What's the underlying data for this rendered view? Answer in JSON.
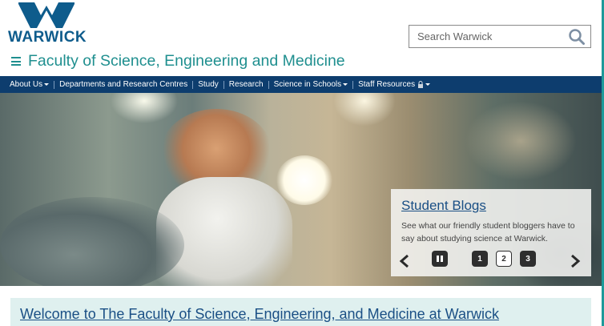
{
  "header": {
    "logo_text": "WARWICK",
    "search": {
      "placeholder": "Search Warwick"
    },
    "faculty_title": "Faculty of Science, Engineering and Medicine"
  },
  "nav": {
    "items": [
      {
        "label": "About Us",
        "has_caret": true
      },
      {
        "label": "Departments and Research Centres",
        "has_caret": false
      },
      {
        "label": "Study",
        "has_caret": false
      },
      {
        "label": "Research",
        "has_caret": false
      },
      {
        "label": "Science in Schools",
        "has_caret": true
      },
      {
        "label": "Staff Resources",
        "has_caret": true,
        "icon": "lock-icon"
      }
    ]
  },
  "hero": {
    "caption_title": "Student Blogs",
    "caption_text": "See what our friendly student bloggers have to say about studying science at Warwick.",
    "slides": [
      "1",
      "2",
      "3"
    ],
    "active_slide": "2",
    "icons": {
      "prev": "chevron-left-icon",
      "pause": "pause-icon",
      "next": "chevron-right-icon"
    }
  },
  "welcome": {
    "heading": "Welcome to The Faculty of Science, Engineering, and Medicine at Warwick"
  },
  "colors": {
    "teal": "#1f8f8f",
    "nav_bg": "#0d3d6e",
    "link_blue": "#1a4f85",
    "welcome_bg": "#dff0ef"
  }
}
